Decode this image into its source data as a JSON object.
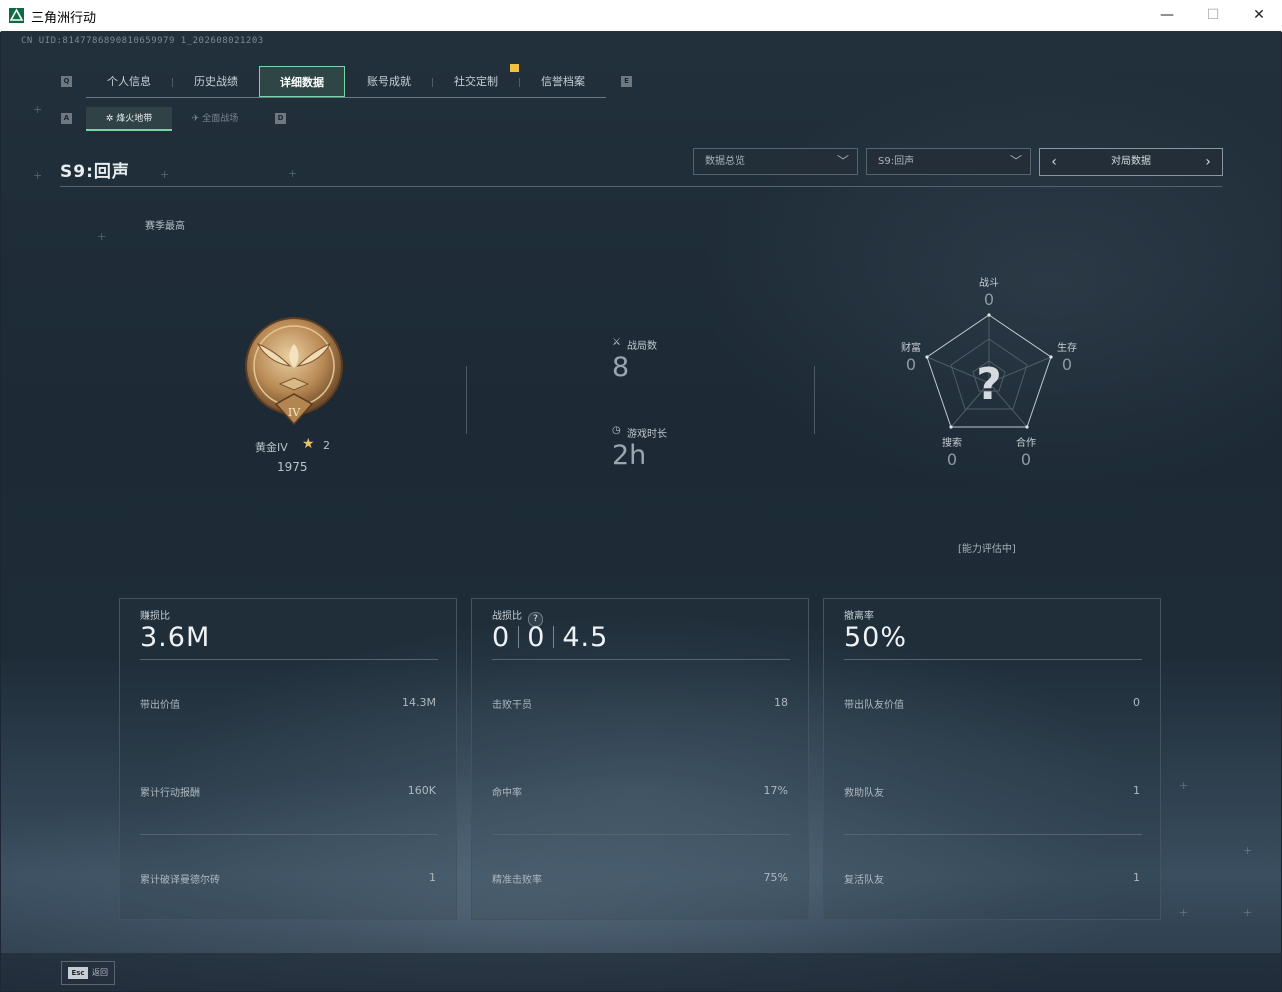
{
  "window": {
    "title": "三角洲行动",
    "minimize": "—",
    "maximize": "☐",
    "close": "✕"
  },
  "uid": "CN UID:8147786890810659979 1_202608021203",
  "key_hints": {
    "tab_left": "Q",
    "tab_right": "E",
    "sub_left": "A",
    "sub_right": "D"
  },
  "tabs": [
    {
      "label": "个人信息",
      "active": false
    },
    {
      "label": "历史战绩",
      "active": false
    },
    {
      "label": "详细数据",
      "active": true
    },
    {
      "label": "账号成就",
      "active": false
    },
    {
      "label": "社交定制",
      "active": false
    },
    {
      "label": "信誉档案",
      "active": false
    }
  ],
  "subtabs": [
    {
      "label": "烽火地带",
      "icon": "✲",
      "active": true
    },
    {
      "label": "全面战场",
      "icon": "✈",
      "active": false
    }
  ],
  "season_title": "S9:回声",
  "dropdowns": {
    "overview": "数据总览",
    "season": "S9:回声"
  },
  "pager": {
    "label": "对局数据",
    "prev": "‹",
    "next": "›"
  },
  "season_high_label": "赛季最高",
  "rank": {
    "name": "黄金IV",
    "stars": "2",
    "score": "1975",
    "numeral": "IV"
  },
  "stats": {
    "matches_label": "战局数",
    "matches_value": "8",
    "playtime_label": "游戏时长",
    "playtime_value": "2h"
  },
  "radar": {
    "center": "?",
    "combat_label": "战斗",
    "combat_value": "0",
    "survival_label": "生存",
    "survival_value": "0",
    "coop_label": "合作",
    "coop_value": "0",
    "search_label": "搜索",
    "search_value": "0",
    "wealth_label": "财富",
    "wealth_value": "0",
    "status": "[能力评估中]"
  },
  "panels": {
    "profit": {
      "title": "赚损比",
      "big": "3.6M",
      "rows": [
        {
          "label": "带出价值",
          "value": "14.3M"
        },
        {
          "label": "累计行动报酬",
          "value": "160K"
        },
        {
          "label": "累计破译曼德尔砖",
          "value": "1"
        }
      ]
    },
    "kd": {
      "title": "战损比",
      "help": "?",
      "kd1": "0",
      "kd2": "0",
      "kd3": "4.5",
      "rows": [
        {
          "label": "击败干员",
          "value": "18"
        },
        {
          "label": "命中率",
          "value": "17%"
        },
        {
          "label": "精准击败率",
          "value": "75%"
        }
      ]
    },
    "extract": {
      "title": "撤离率",
      "big": "50%",
      "rows": [
        {
          "label": "带出队友价值",
          "value": "0"
        },
        {
          "label": "救助队友",
          "value": "1"
        },
        {
          "label": "复活队友",
          "value": "1"
        }
      ]
    }
  },
  "footer": {
    "esc_key": "Esc",
    "esc_label": "返回"
  },
  "colors": {
    "accent": "#7bd4a8",
    "notify": "#f0c040",
    "star": "#e6c36a"
  }
}
